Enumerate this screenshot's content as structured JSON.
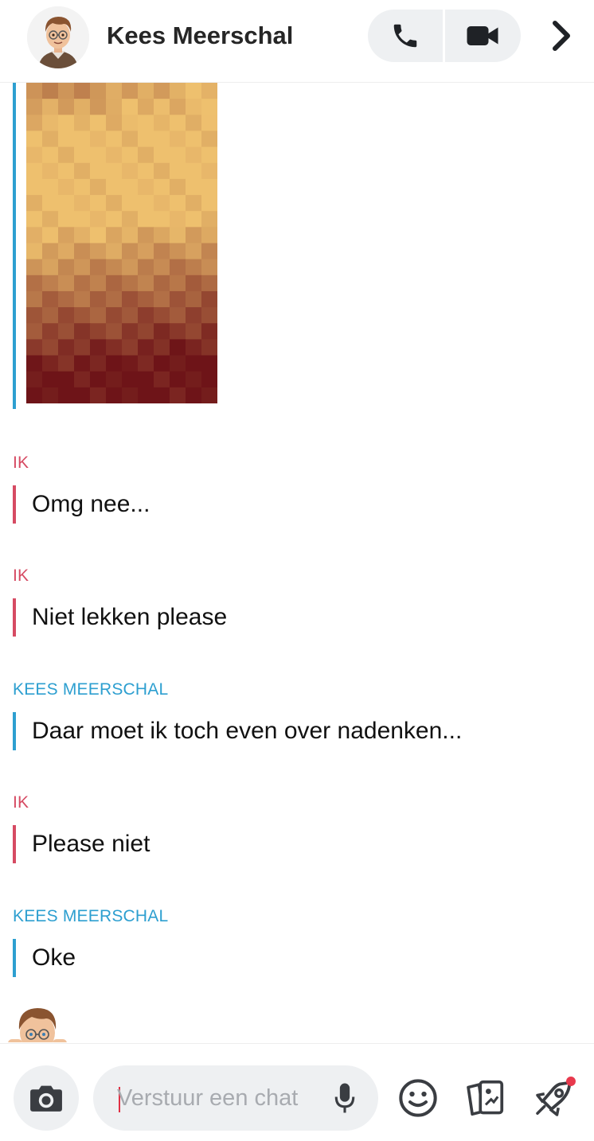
{
  "header": {
    "contact_name": "Kees Meerschal",
    "icons": [
      "avatar",
      "phone-icon",
      "video-camera-icon",
      "chevron-right-icon"
    ]
  },
  "chat": {
    "snap": {
      "icon": "snap-thumbnail",
      "sender_color": "#2d9fd0"
    },
    "messages": [
      {
        "sender": "IK",
        "text": "Omg nee...",
        "from_me": true
      },
      {
        "sender": "IK",
        "text": "Niet lekken please",
        "from_me": true
      },
      {
        "sender": "KEES MEERSCHAL",
        "text": "Daar moet ik toch even over nadenken...",
        "from_me": false
      },
      {
        "sender": "IK",
        "text": "Please niet",
        "from_me": true
      },
      {
        "sender": "KEES MEERSCHAL",
        "text": "Oke",
        "from_me": false
      }
    ]
  },
  "composer": {
    "placeholder": "Verstuur een chat",
    "icons": [
      "camera-icon",
      "microphone-icon",
      "smiley-icon",
      "cards-icon",
      "rocket-icon"
    ]
  },
  "colors": {
    "me": "#d64b63",
    "friend": "#2d9fd0",
    "pill_bg": "#eef0f2",
    "notification_dot": "#e8394d"
  }
}
